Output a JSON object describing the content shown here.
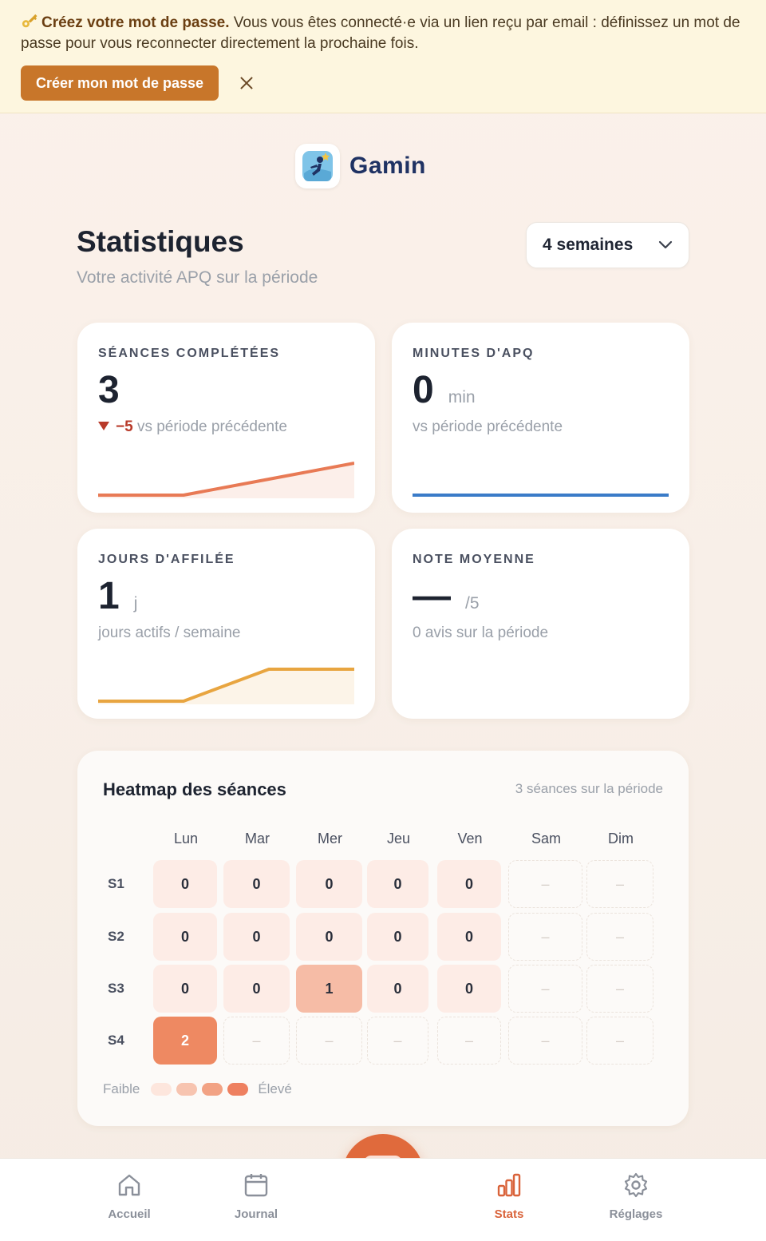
{
  "banner": {
    "title": "Créez votre mot de passe.",
    "message": " Vous vous êtes connecté·e via un lien reçu par email : définissez un mot de passe pour vous reconnecter directement la prochaine fois.",
    "cta_label": "Créer mon mot de passe",
    "icon": "key-icon"
  },
  "brand": {
    "name": "Gamin"
  },
  "header": {
    "title": "Statistiques",
    "subtitle": "Votre activité APQ sur la période",
    "period": "4 semaines"
  },
  "cards": [
    {
      "label": "SÉANCES COMPLÉTÉES",
      "value": "3",
      "unit": "",
      "delta": "−5",
      "meta": "vs période précédente",
      "spark_color": "#e87a55",
      "spark_values": [
        0,
        0,
        1,
        2
      ]
    },
    {
      "label": "MINUTES D'APQ",
      "value": "0",
      "unit": "min",
      "delta": "",
      "meta": "vs période précédente",
      "spark_color": "#3a7bc8",
      "spark_values": [
        0,
        0,
        0,
        0
      ]
    },
    {
      "label": "JOURS D'AFFILÉE",
      "value": "1",
      "unit": "j",
      "delta": "",
      "meta": "jours actifs / semaine",
      "spark_color": "#e8a540",
      "spark_values": [
        0,
        0,
        1,
        1
      ]
    },
    {
      "label": "NOTE MOYENNE",
      "value": "—",
      "unit": "/5",
      "delta": "",
      "meta": "0 avis sur la période",
      "spark_color": "",
      "spark_values": []
    }
  ],
  "heatmap": {
    "title": "Heatmap des séances",
    "count": "3 séances sur la période",
    "days": [
      "Lun",
      "Mar",
      "Mer",
      "Jeu",
      "Ven",
      "Sam",
      "Dim"
    ],
    "weeks": [
      "S1",
      "S2",
      "S3",
      "S4"
    ],
    "values": [
      [
        "0",
        "0",
        "0",
        "0",
        "0",
        "–",
        "–"
      ],
      [
        "0",
        "0",
        "0",
        "0",
        "0",
        "–",
        "–"
      ],
      [
        "0",
        "0",
        "1",
        "0",
        "0",
        "–",
        "–"
      ],
      [
        "2",
        "–",
        "–",
        "–",
        "–",
        "–",
        "–"
      ]
    ],
    "legend_low": "Faible",
    "legend_high": "Élevé",
    "colors": [
      "#fdece6",
      "#f6bca6",
      "#ee8962"
    ]
  },
  "nav": [
    {
      "label": "Accueil",
      "icon": "home-icon"
    },
    {
      "label": "Journal",
      "icon": "calendar-icon"
    },
    {
      "label": "Stats",
      "icon": "bar-chart-icon",
      "active": true
    },
    {
      "label": "Réglages",
      "icon": "gear-icon"
    }
  ],
  "fab_icon": "qr-code-icon"
}
